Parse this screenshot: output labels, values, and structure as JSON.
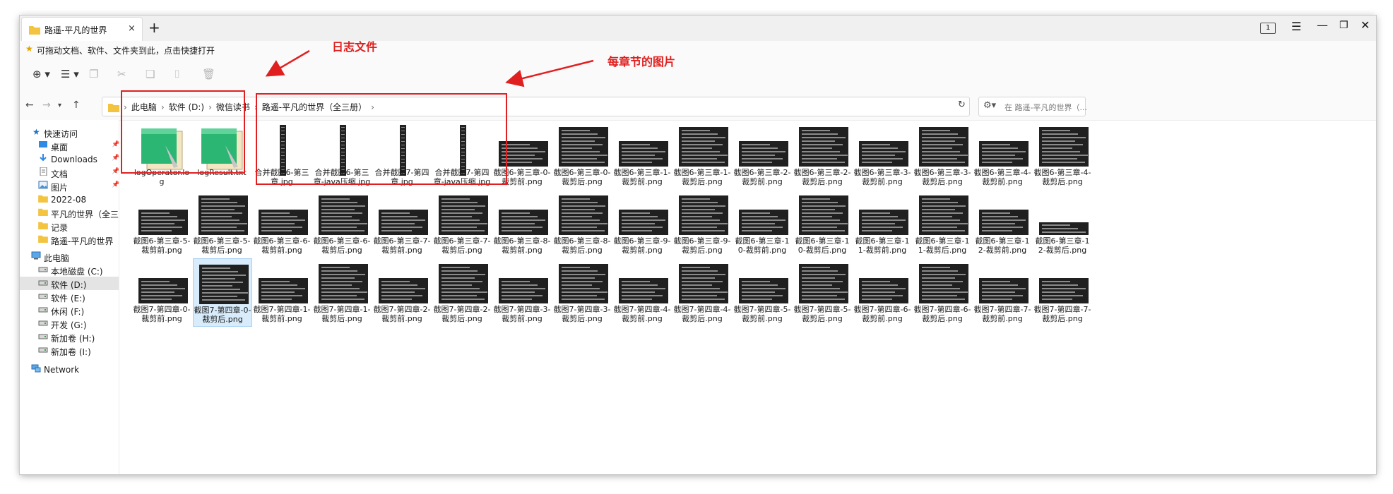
{
  "window": {
    "tab_title": "路遥-平凡的世界",
    "tab_close": "×",
    "new_tab": "+",
    "tab_count": "1"
  },
  "colors": {
    "accent": "#0067c0",
    "annotation": "#e02020",
    "folder": "#f3c440",
    "selected": "#d8ecfb"
  },
  "bookmark_bar": {
    "text": "可拖动文档、软件、文件夹到此，点击快捷打开"
  },
  "breadcrumb": [
    "此电脑",
    "软件 (D:)",
    "微信读书",
    "路遥-平凡的世界（全三册）"
  ],
  "search": {
    "placeholder": "在 路遥-平凡的世界（..."
  },
  "sidebar": {
    "quick_access": "快速访问",
    "items": [
      {
        "label": "桌面",
        "icon": "desktop-icon",
        "pinned": true
      },
      {
        "label": "Downloads",
        "icon": "download-icon",
        "pinned": true
      },
      {
        "label": "文档",
        "icon": "document-icon",
        "pinned": true
      },
      {
        "label": "图片",
        "icon": "picture-icon",
        "pinned": true
      },
      {
        "label": "2022-08",
        "icon": "folder-icon",
        "pinned": false
      },
      {
        "label": "平凡的世界（全三册）",
        "icon": "folder-icon",
        "pinned": false
      },
      {
        "label": "记录",
        "icon": "folder-icon",
        "pinned": false
      },
      {
        "label": "路遥-平凡的世界（全三",
        "icon": "folder-icon",
        "pinned": false
      }
    ],
    "this_pc": "此电脑",
    "drives": [
      {
        "label": "本地磁盘 (C:)",
        "selected": false
      },
      {
        "label": "软件 (D:)",
        "selected": true
      },
      {
        "label": "软件 (E:)",
        "selected": false
      },
      {
        "label": "休闲 (F:)",
        "selected": false
      },
      {
        "label": "开发 (G:)",
        "selected": false
      },
      {
        "label": "新加卷 (H:)",
        "selected": false
      },
      {
        "label": "新加卷 (I:)",
        "selected": false
      }
    ],
    "network": "Network"
  },
  "annotations": {
    "log_files": "日志文件",
    "chapter_images": "每章节的图片"
  },
  "files": [
    {
      "name": "logOperator.log",
      "kind": "log"
    },
    {
      "name": "logResult.txt",
      "kind": "log"
    },
    {
      "name": "合并截图6-第三章.jpg",
      "kind": "strip"
    },
    {
      "name": "合并截图6-第三章-java压缩.jpg",
      "kind": "strip"
    },
    {
      "name": "合并截图7-第四章.jpg",
      "kind": "strip"
    },
    {
      "name": "合并截图7-第四章-java压缩.jpg",
      "kind": "strip"
    },
    {
      "name": "截图6-第三章-0-裁剪前.png",
      "kind": "short"
    },
    {
      "name": "截图6-第三章-0-裁剪后.png",
      "kind": "tall"
    },
    {
      "name": "截图6-第三章-1-裁剪前.png",
      "kind": "short"
    },
    {
      "name": "截图6-第三章-1-裁剪后.png",
      "kind": "tall"
    },
    {
      "name": "截图6-第三章-2-裁剪前.png",
      "kind": "short"
    },
    {
      "name": "截图6-第三章-2-裁剪后.png",
      "kind": "tall"
    },
    {
      "name": "截图6-第三章-3-裁剪前.png",
      "kind": "short"
    },
    {
      "name": "截图6-第三章-3-裁剪后.png",
      "kind": "tall"
    },
    {
      "name": "截图6-第三章-4-裁剪前.png",
      "kind": "short"
    },
    {
      "name": "截图6-第三章-4-裁剪后.png",
      "kind": "tall"
    },
    {
      "name": "截图6-第三章-5-裁剪前.png",
      "kind": "short"
    },
    {
      "name": "截图6-第三章-5-裁剪后.png",
      "kind": "tall"
    },
    {
      "name": "截图6-第三章-6-裁剪前.png",
      "kind": "short"
    },
    {
      "name": "截图6-第三章-6-裁剪后.png",
      "kind": "tall"
    },
    {
      "name": "截图6-第三章-7-裁剪前.png",
      "kind": "short"
    },
    {
      "name": "截图6-第三章-7-裁剪后.png",
      "kind": "tall"
    },
    {
      "name": "截图6-第三章-8-裁剪前.png",
      "kind": "short"
    },
    {
      "name": "截图6-第三章-8-裁剪后.png",
      "kind": "tall"
    },
    {
      "name": "截图6-第三章-9-裁剪前.png",
      "kind": "short"
    },
    {
      "name": "截图6-第三章-9-裁剪后.png",
      "kind": "tall"
    },
    {
      "name": "截图6-第三章-10-裁剪前.png",
      "kind": "short"
    },
    {
      "name": "截图6-第三章-10-裁剪后.png",
      "kind": "tall"
    },
    {
      "name": "截图6-第三章-11-裁剪前.png",
      "kind": "short"
    },
    {
      "name": "截图6-第三章-11-裁剪后.png",
      "kind": "tall"
    },
    {
      "name": "截图6-第三章-12-裁剪前.png",
      "kind": "short"
    },
    {
      "name": "截图6-第三章-12-裁剪后.png",
      "kind": "tiny"
    },
    {
      "name": "截图7-第四章-0-裁剪前.png",
      "kind": "short"
    },
    {
      "name": "截图7-第四章-0-裁剪后.png",
      "kind": "tall",
      "selected": true
    },
    {
      "name": "截图7-第四章-1-裁剪前.png",
      "kind": "short"
    },
    {
      "name": "截图7-第四章-1-裁剪后.png",
      "kind": "tall"
    },
    {
      "name": "截图7-第四章-2-裁剪前.png",
      "kind": "short"
    },
    {
      "name": "截图7-第四章-2-裁剪后.png",
      "kind": "tall"
    },
    {
      "name": "截图7-第四章-3-裁剪前.png",
      "kind": "short"
    },
    {
      "name": "截图7-第四章-3-裁剪后.png",
      "kind": "tall"
    },
    {
      "name": "截图7-第四章-4-裁剪前.png",
      "kind": "short"
    },
    {
      "name": "截图7-第四章-4-裁剪后.png",
      "kind": "tall"
    },
    {
      "name": "截图7-第四章-5-裁剪前.png",
      "kind": "short"
    },
    {
      "name": "截图7-第四章-5-裁剪后.png",
      "kind": "tall"
    },
    {
      "name": "截图7-第四章-6-裁剪前.png",
      "kind": "short"
    },
    {
      "name": "截图7-第四章-6-裁剪后.png",
      "kind": "tall"
    },
    {
      "name": "截图7-第四章-7-裁剪前.png",
      "kind": "short"
    },
    {
      "name": "截图7-第四章-7-裁剪后.png",
      "kind": "short"
    }
  ]
}
